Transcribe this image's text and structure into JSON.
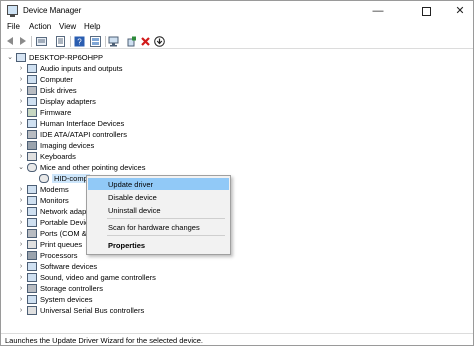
{
  "window": {
    "title": "Device Manager"
  },
  "titlebar": {
    "minimize": "—",
    "close": "✕"
  },
  "menu": [
    "File",
    "Action",
    "View",
    "Help"
  ],
  "toolbar": [
    "back-icon",
    "forward-icon",
    "properties-icon",
    "list-icon",
    "help-icon",
    "view-icon",
    "scan-icon",
    "add-driver-icon",
    "uninstall-icon",
    "download-icon"
  ],
  "tree": {
    "root": "DESKTOP-RP6OHPP",
    "categories": [
      "Audio inputs and outputs",
      "Computer",
      "Disk drives",
      "Display adapters",
      "Firmware",
      "Human Interface Devices",
      "IDE ATA/ATAPI controllers",
      "Imaging devices",
      "Keyboards",
      "Mice and other pointing devices",
      "HID-comp",
      "Modems",
      "Monitors",
      "Network adapt",
      "Portable Devic",
      "Ports (COM &",
      "Print queues",
      "Processors",
      "Software devices",
      "Sound, video and game controllers",
      "Storage controllers",
      "System devices",
      "Universal Serial Bus controllers"
    ]
  },
  "context_menu": {
    "update": "Update driver",
    "disable": "Disable device",
    "uninstall": "Uninstall device",
    "scan": "Scan for hardware changes",
    "properties": "Properties"
  },
  "status": "Launches the Update Driver Wizard for the selected device.",
  "colors": {
    "highlight": "#91c9f7",
    "accent_red": "#d11a1a",
    "accent_green": "#2e8b3a",
    "accent_blue": "#2a5db0"
  }
}
